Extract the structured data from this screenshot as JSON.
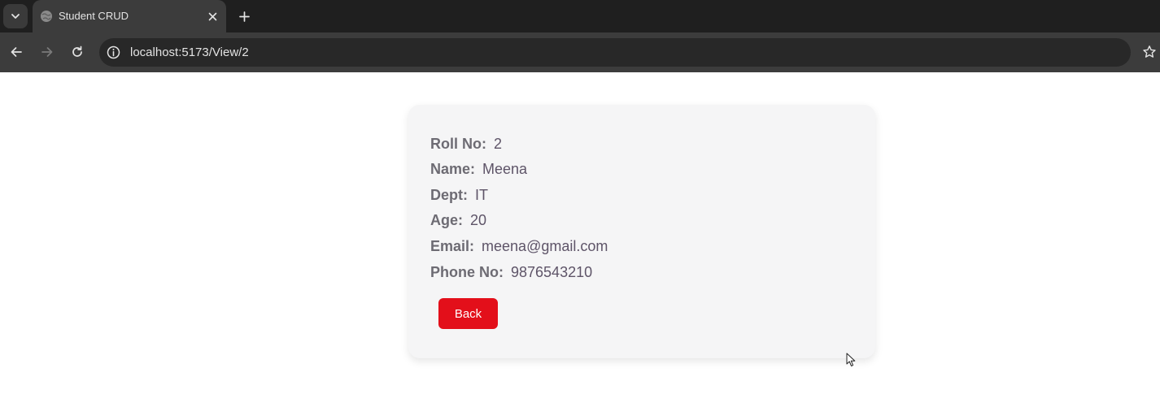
{
  "browser": {
    "tab": {
      "title": "Student CRUD"
    },
    "url": "localhost:5173/View/2"
  },
  "student": {
    "fields": [
      {
        "label": "Roll No:",
        "value": "2"
      },
      {
        "label": "Name:",
        "value": "Meena"
      },
      {
        "label": "Dept:",
        "value": "IT"
      },
      {
        "label": "Age:",
        "value": "20"
      },
      {
        "label": "Email:",
        "value": "meena@gmail.com"
      },
      {
        "label": "Phone No:",
        "value": "9876543210"
      }
    ],
    "back_label": "Back"
  },
  "colors": {
    "back_button": "#e30f1a",
    "card_background": "#f5f5f6",
    "label_text": "#6d6b73",
    "value_text": "#5e5468"
  },
  "icons": {
    "tab_list": "chevron-down-icon",
    "favicon": "globe-icon",
    "close": "close-icon",
    "new_tab": "plus-icon",
    "back": "arrow-left-icon",
    "forward": "arrow-right-icon",
    "reload": "reload-icon",
    "site_info": "info-icon",
    "bookmark": "star-icon",
    "cursor": "mouse-pointer-icon"
  }
}
